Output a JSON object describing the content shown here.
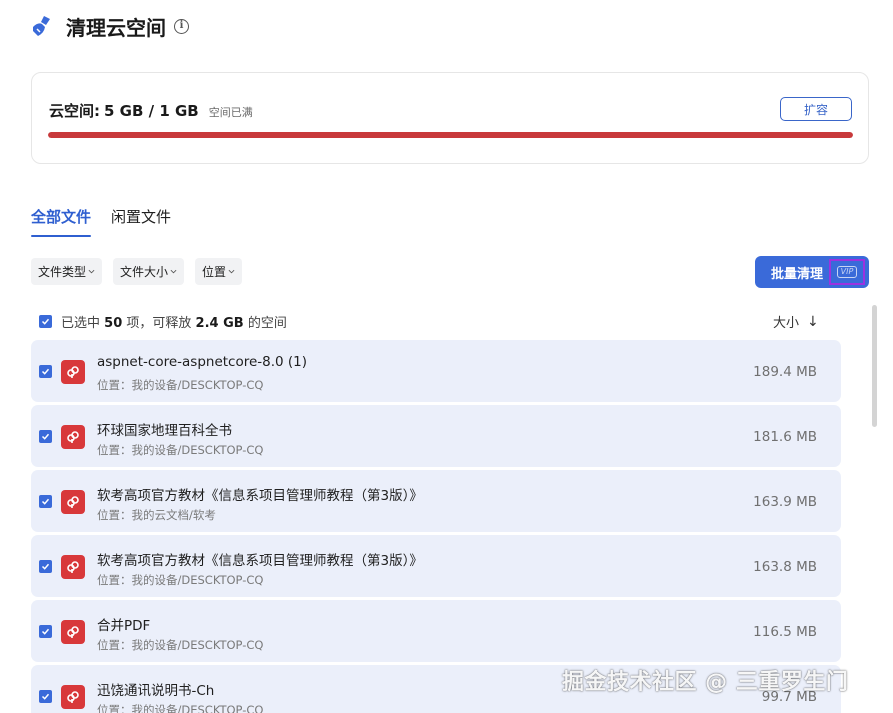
{
  "header": {
    "title": "清理云空间",
    "icon": "broom-icon",
    "info_icon": "info-icon",
    "info_glyph": "i"
  },
  "storage": {
    "label": "云空间:",
    "value": "5 GB / 1 GB",
    "status": "空间已满",
    "expand_label": "扩容",
    "usage_fraction": 1.0,
    "bar_color": "#c8393b"
  },
  "tabs": [
    {
      "label": "全部文件",
      "active": true
    },
    {
      "label": "闲置文件",
      "active": false
    }
  ],
  "filters": [
    {
      "label": "文件类型"
    },
    {
      "label": "文件大小"
    },
    {
      "label": "位置"
    }
  ],
  "batch": {
    "label": "批量清理",
    "badge": "VIP"
  },
  "summary": {
    "prefix": "已选中",
    "count": "50",
    "mid": "项，可释放",
    "size": "2.4 GB",
    "suffix": "的空间"
  },
  "sort": {
    "label": "大小",
    "arrow": "↓"
  },
  "files": [
    {
      "name": "aspnet-core-aspnetcore-8.0 (1)",
      "location": "位置：我的设备/DESCKTOP-CQ",
      "size": "189.4 MB",
      "checked": true
    },
    {
      "name": "环球国家地理百科全书",
      "location": "位置：我的设备/DESCKTOP-CQ",
      "size": "181.6 MB",
      "checked": true
    },
    {
      "name": "软考高项官方教材《信息系项目管理师教程（第3版）》",
      "location": "位置：我的云文档/软考",
      "size": "163.9 MB",
      "checked": true
    },
    {
      "name": "软考高项官方教材《信息系项目管理师教程（第3版）》",
      "location": "位置：我的设备/DESCKTOP-CQ",
      "size": "163.8 MB",
      "checked": true
    },
    {
      "name": "合并PDF",
      "location": "位置：我的设备/DESCKTOP-CQ",
      "size": "116.5 MB",
      "checked": true
    },
    {
      "name": "迅饶通讯说明书-Ch",
      "location": "位置：我的设备/DESCKTOP-CQ",
      "size": "99.7 MB",
      "checked": true
    }
  ],
  "watermark": "掘金技术社区 @ 三重罗生门",
  "colors": {
    "accent": "#3a6ad9",
    "danger": "#c8393b",
    "row_bg": "#ebeffa"
  }
}
